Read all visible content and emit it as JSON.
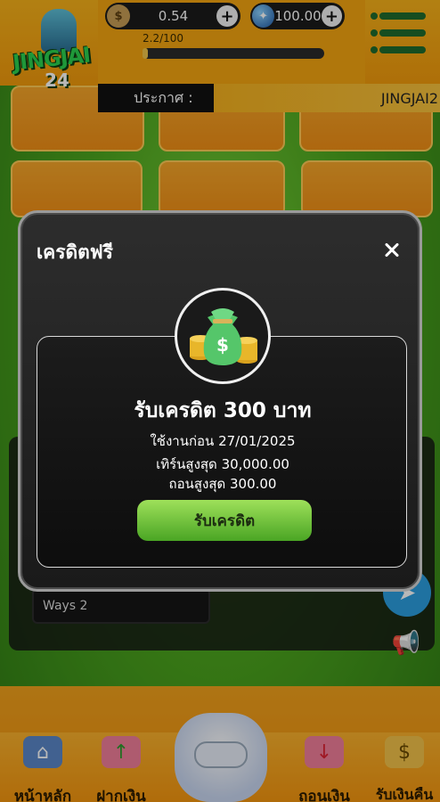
{
  "header": {
    "logo_text": "JINGJAI",
    "logo_number": "24",
    "credit_icon": "$",
    "credit_value": "0.54",
    "diamond_value": "100.00",
    "xp_text": "2.2/100",
    "xp_fraction": 0.022
  },
  "announcement": {
    "label": "ประกาศ :",
    "ticker_text": "JINGJAI2"
  },
  "background": {
    "ways_label": "Ways 2"
  },
  "modal": {
    "title": "เครดิตฟรี",
    "reward_title": "รับเครดิต 300 บาท",
    "expiry": "ใช้งานก่อน 27/01/2025",
    "turnover": "เทิร์นสูงสุด 30,000.00",
    "withdraw_max": "ถอนสูงสุด 300.00",
    "claim_label": "รับเครดิต",
    "bag_symbol": "$"
  },
  "bottom_nav": {
    "items": [
      {
        "label": "หน้าหลัก",
        "icon": "home-icon"
      },
      {
        "label": "ฝากเงิน",
        "icon": "deposit-piggy-icon"
      },
      {
        "label": "",
        "icon": "game-controller-icon"
      },
      {
        "label": "ถอนเงิน",
        "icon": "withdraw-piggy-icon"
      },
      {
        "label": "รับเงินคืน",
        "icon": "cashback-icon"
      }
    ]
  },
  "colors": {
    "header": "#f29a0c",
    "modal_bg": "#1a1a1a",
    "claim_button": "#6fc13a",
    "telegram": "#2b9fe0"
  }
}
